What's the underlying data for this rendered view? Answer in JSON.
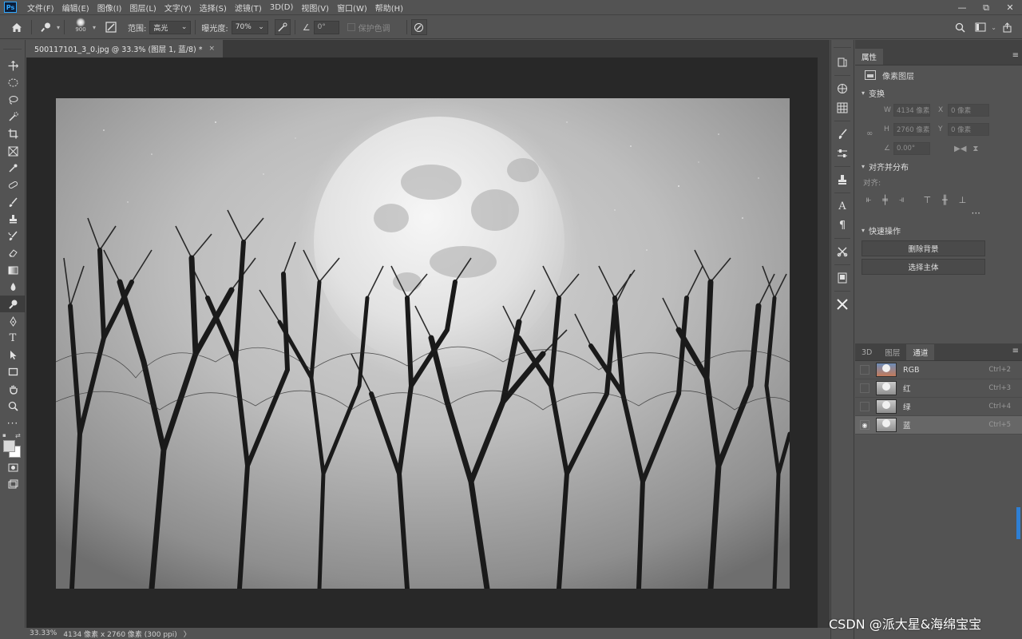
{
  "menubar": {
    "logo": "Ps",
    "items": [
      "文件(F)",
      "编辑(E)",
      "图像(I)",
      "图层(L)",
      "文字(Y)",
      "选择(S)",
      "滤镜(T)",
      "3D(D)",
      "视图(V)",
      "窗口(W)",
      "帮助(H)"
    ],
    "window_controls": [
      "—",
      "⧉",
      "✕"
    ]
  },
  "options": {
    "brush_size": "900",
    "range_label": "范围:",
    "range_value": "高光",
    "exposure_label": "曝光度:",
    "exposure_value": "70%",
    "angle_value": "0°",
    "protect_label": "保护色调"
  },
  "document": {
    "tab_title": "500117101_3_0.jpg @ 33.3% (图层 1, 蓝/8) *",
    "tab_close": "×"
  },
  "status": {
    "zoom": "33.33%",
    "dimensions": "4134 像素 x 2760 像素 (300 ppi)",
    "arrow": "〉"
  },
  "properties": {
    "tab": "属性",
    "layer_type": "像素图层",
    "transform_heading": "变换",
    "w_label": "W",
    "w_value": "4134 像素",
    "x_label": "X",
    "x_value": "0 像素",
    "h_label": "H",
    "h_value": "2760 像素",
    "y_label": "Y",
    "y_value": "0 像素",
    "angle_value": "0.00°",
    "align_heading": "对齐并分布",
    "align_label": "对齐:",
    "quick_heading": "快速操作",
    "quick_buttons": [
      "删除背景",
      "选择主体"
    ]
  },
  "channels": {
    "tabs": [
      "3D",
      "图层",
      "通道"
    ],
    "items": [
      {
        "name": "RGB",
        "shortcut": "Ctrl+2"
      },
      {
        "name": "红",
        "shortcut": "Ctrl+3"
      },
      {
        "name": "绿",
        "shortcut": "Ctrl+4"
      },
      {
        "name": "蓝",
        "shortcut": "Ctrl+5"
      }
    ]
  },
  "watermark": "CSDN @派大星&海绵宝宝",
  "colors": {
    "accent": "#31a8ff",
    "panel_bg": "#535353",
    "canvas_bg": "#282828"
  }
}
